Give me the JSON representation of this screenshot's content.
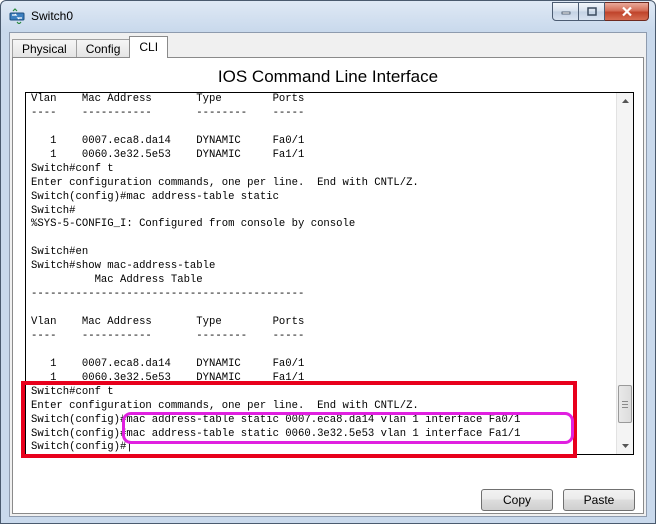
{
  "window": {
    "title": "Switch0",
    "icon": "switch-device-icon",
    "controls": [
      "minimize-icon",
      "maximize-icon",
      "close-icon"
    ]
  },
  "tabs": [
    {
      "label": "Physical",
      "active": false
    },
    {
      "label": "Config",
      "active": false
    },
    {
      "label": "CLI",
      "active": true
    }
  ],
  "cli": {
    "heading": "IOS Command Line Interface",
    "terminal_lines": [
      "Vlan    Mac Address       Type        Ports",
      "----    -----------       --------    -----",
      "",
      "   1    0007.eca8.da14    DYNAMIC     Fa0/1",
      "   1    0060.3e32.5e53    DYNAMIC     Fa1/1",
      "Switch#conf t",
      "Enter configuration commands, one per line.  End with CNTL/Z.",
      "Switch(config)#mac address-table static",
      "Switch#",
      "%SYS-5-CONFIG_I: Configured from console by console",
      "",
      "Switch#en",
      "Switch#show mac-address-table",
      "          Mac Address Table",
      "-------------------------------------------",
      "",
      "Vlan    Mac Address       Type        Ports",
      "----    -----------       --------    -----",
      "",
      "   1    0007.eca8.da14    DYNAMIC     Fa0/1",
      "   1    0060.3e32.5e53    DYNAMIC     Fa1/1",
      "Switch#conf t",
      "Enter configuration commands, one per line.  End with CNTL/Z.",
      "Switch(config)#mac address-table static 0007.eca8.da14 vlan 1 interface Fa0/1",
      "Switch(config)#mac address-table static 0060.3e32.5e53 vlan 1 interface Fa1/1",
      "Switch(config)#|"
    ],
    "scroll_position": 0.95,
    "copy_label": "Copy",
    "paste_label": "Paste"
  },
  "annotations": {
    "red_box_color": "#e8001c",
    "magenta_box_color": "#e020e0"
  }
}
